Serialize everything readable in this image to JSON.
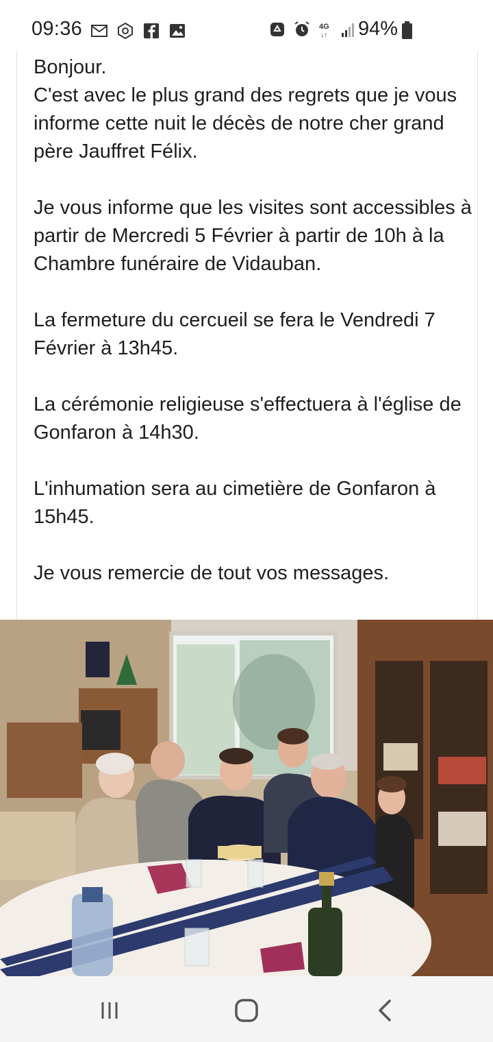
{
  "status_bar": {
    "time": "09:36",
    "battery_percent": "94%",
    "network": "4G",
    "left_icons": [
      "mail-icon",
      "location-share-icon",
      "facebook-icon",
      "gallery-icon"
    ],
    "right_icons": [
      "recycle-icon",
      "alarm-icon",
      "4g-icon",
      "signal-icon",
      "battery-icon"
    ]
  },
  "message": {
    "paragraphs": [
      "Bonjour.\nC'est avec le plus grand des regrets que je vous informe cette nuit le décès de notre cher grand père Jauffret Félix.",
      "Je vous informe que les visites sont accessibles à partir de Mercredi 5 Février à partir de 10h à la Chambre funéraire de Vidauban.",
      "La fermeture du cercueil se fera le Vendredi 7 Février à 13h45.",
      "La cérémonie religieuse s'effectuera à l'église de Gonfaron à 14h30.",
      "L'inhumation sera au cimetière de Gonfaron à 15h45.",
      "Je vous remercie de tout vos messages."
    ]
  },
  "photo": {
    "subject": "family-gathering-photo"
  },
  "nav_bar": {
    "buttons": [
      "recent-apps-button",
      "home-button",
      "back-button"
    ]
  }
}
